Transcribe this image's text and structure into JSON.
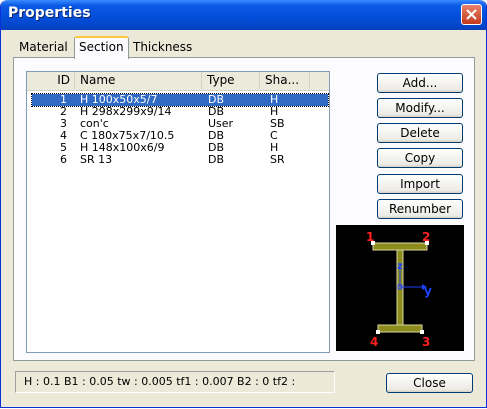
{
  "window": {
    "title": "Properties"
  },
  "tabs": [
    {
      "label": "Material",
      "active": false
    },
    {
      "label": "Section",
      "active": true
    },
    {
      "label": "Thickness",
      "active": false
    }
  ],
  "table": {
    "columns": [
      "ID",
      "Name",
      "Type",
      "Sha..."
    ],
    "rows": [
      {
        "id": "1",
        "name": "H 100x50x5/7",
        "type": "DB",
        "shape": "H",
        "selected": true
      },
      {
        "id": "2",
        "name": "H 298x299x9/14",
        "type": "DB",
        "shape": "H"
      },
      {
        "id": "3",
        "name": "con'c",
        "type": "User",
        "shape": "SB"
      },
      {
        "id": "4",
        "name": "C 180x75x7/10.5",
        "type": "DB",
        "shape": "C"
      },
      {
        "id": "5",
        "name": "H 148x100x6/9",
        "type": "DB",
        "shape": "H"
      },
      {
        "id": "6",
        "name": "SR 13",
        "type": "DB",
        "shape": "SR"
      }
    ]
  },
  "buttons": {
    "add": "Add...",
    "modify": "Modify...",
    "delete": "Delete",
    "copy": "Copy",
    "import": "Import",
    "renumber": "Renumber",
    "close": "Close"
  },
  "preview": {
    "corner_labels": [
      "1",
      "2",
      "3",
      "4"
    ],
    "axis_z": "z",
    "axis_y": "y",
    "colors": {
      "section": "#8c8c1e",
      "labels": "#ff2020",
      "axes": "#2040ff",
      "background": "#000000"
    }
  },
  "status": "H : 0.1   B1 : 0.05   tw : 0.005   tf1 : 0.007   B2 : 0   tf2 :"
}
